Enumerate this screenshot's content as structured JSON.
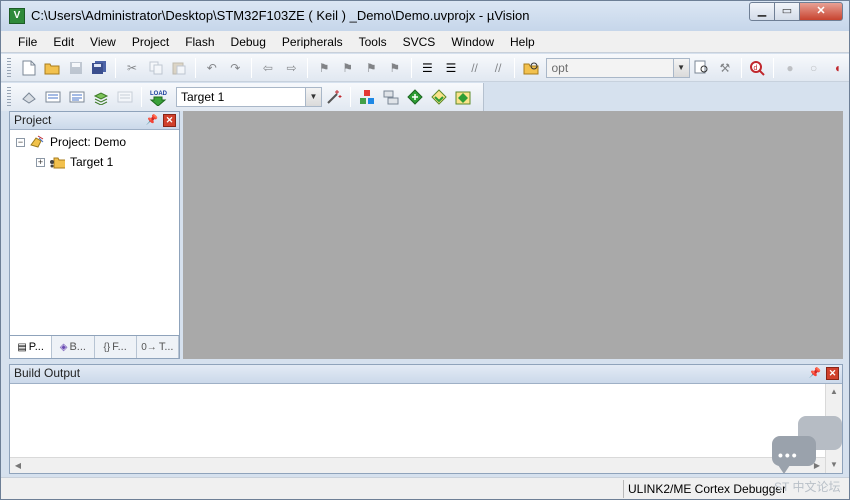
{
  "window": {
    "title": "C:\\Users\\Administrator\\Desktop\\STM32F103ZE ( Keil ) _Demo\\Demo.uvprojx - µVision",
    "app_icon_label": "V"
  },
  "menu": [
    "File",
    "Edit",
    "View",
    "Project",
    "Flash",
    "Debug",
    "Peripherals",
    "Tools",
    "SVCS",
    "Window",
    "Help"
  ],
  "toolbar": {
    "find_combo_value": "opt",
    "target_combo_value": "Target 1"
  },
  "project_pane": {
    "title": "Project",
    "tree": [
      {
        "label": "Project: Demo",
        "expander": "−"
      },
      {
        "label": "Target 1",
        "expander": "+"
      }
    ],
    "tabs": [
      {
        "icon": "project-tab-icon",
        "label": "P..."
      },
      {
        "icon": "books-tab-icon",
        "label": "B..."
      },
      {
        "icon": "functions-tab-icon",
        "glyph": "{}",
        "label": "F..."
      },
      {
        "icon": "templates-tab-icon",
        "glyph": "0→",
        "label": "T..."
      }
    ]
  },
  "build_output": {
    "title": "Build Output",
    "content": ""
  },
  "status": {
    "debugger": "ULINK2/ME Cortex Debugger",
    "watermark": "ST 中文论坛"
  },
  "colors": {
    "editor_bg": "#a9a9a9",
    "close_red": "#d0402c",
    "chrome_blue": "#d6e1ee"
  }
}
